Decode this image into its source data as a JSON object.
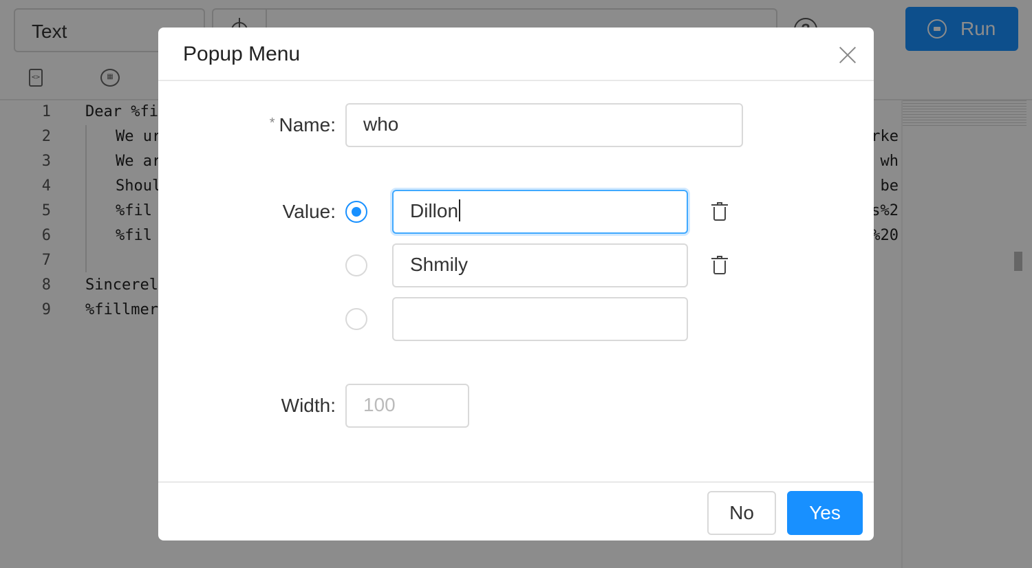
{
  "toolbar": {
    "type_value": "Text",
    "run_label": "Run"
  },
  "editor": {
    "lines": [
      {
        "num": "1",
        "text": "Dear %fi",
        "right": ""
      },
      {
        "num": "2",
        "text": "We ur",
        "right": "rke"
      },
      {
        "num": "3",
        "text": "We ar",
        "right": "wh"
      },
      {
        "num": "4",
        "text": "Shoul",
        "right": "be"
      },
      {
        "num": "5",
        "text": "%fil",
        "right": "s%2"
      },
      {
        "num": "6",
        "text": "%fil",
        "right": "%20"
      },
      {
        "num": "7",
        "text": "",
        "right": ""
      },
      {
        "num": "8",
        "text": "Sincerel",
        "right": ""
      },
      {
        "num": "9",
        "text": "%fillmer",
        "right": ""
      }
    ]
  },
  "modal": {
    "title": "Popup Menu",
    "name_label": "Name",
    "name_required": "*",
    "name_value": "who",
    "value_label": "Value",
    "values": [
      {
        "text": "Dillon",
        "selected": true
      },
      {
        "text": "Shmily",
        "selected": false
      },
      {
        "text": "",
        "selected": false
      }
    ],
    "width_label": "Width",
    "width_placeholder": "100",
    "no_label": "No",
    "yes_label": "Yes"
  },
  "colors": {
    "primary": "#1890ff",
    "overlay": "rgba(0,0,0,0.45)"
  }
}
